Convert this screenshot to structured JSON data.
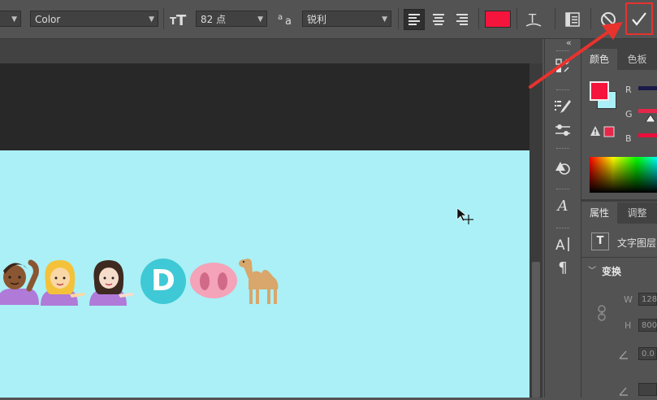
{
  "options_bar": {
    "font_style_value": "Color",
    "font_size_value": "82 点",
    "antialias_value": "锐利",
    "text_color": "#f5143c",
    "toolbar_icons": [
      "font-size-icon",
      "aa-icon",
      "align-left-icon",
      "align-center-icon",
      "align-right-icon",
      "warp-text-icon",
      "character-panel-icon",
      "cancel-icon",
      "commit-check-icon"
    ]
  },
  "color_panel": {
    "tab_active": "颜色",
    "tab_inactive": "色板",
    "channel_r": "R",
    "channel_g": "G",
    "channel_b": "B",
    "foreground_color": "#f5143c",
    "background_color": "#aaf0f6"
  },
  "properties_panel": {
    "tab_active": "属性",
    "tab_inactive": "调整",
    "layer_type": "文字图层",
    "section_transform": "变换",
    "w_label": "W",
    "h_label": "H",
    "w_value": "128",
    "h_value": "800",
    "angle_value": "0.0"
  },
  "canvas": {
    "background": "#aaf0f6",
    "emoji_text": "🙆🏽💁🏼💁🏻🅳🐽🐪",
    "letter_d": "D"
  }
}
